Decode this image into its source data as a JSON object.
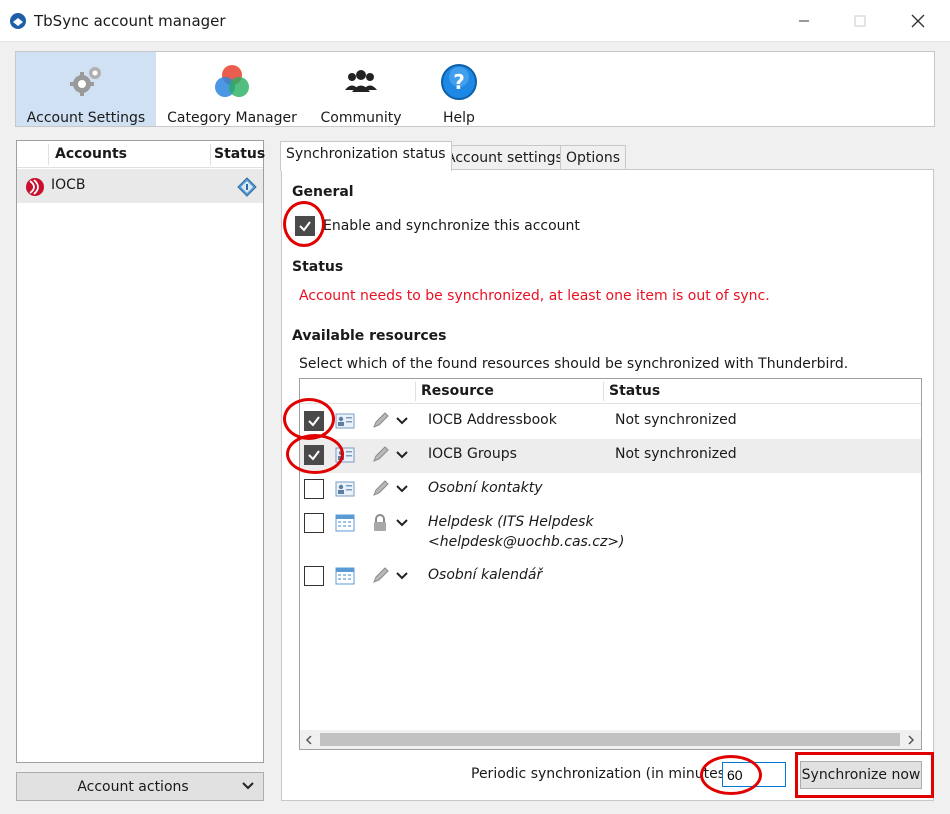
{
  "window": {
    "title": "TbSync account manager"
  },
  "toolbar": {
    "items": [
      {
        "label": "Account Settings",
        "icon": "gears-icon"
      },
      {
        "label": "Category Manager",
        "icon": "category-circles-icon"
      },
      {
        "label": "Community",
        "icon": "people-icon"
      },
      {
        "label": "Help",
        "icon": "help-icon"
      }
    ]
  },
  "accounts": {
    "col_accounts": "Accounts",
    "col_status": "Status",
    "items": [
      {
        "name": "IOCB",
        "icon": "exchange-provider-icon",
        "status_icon": "status-badge-icon"
      }
    ],
    "actions_label": "Account actions"
  },
  "tabs": [
    {
      "label": "Synchronization status"
    },
    {
      "label": "Account settings"
    },
    {
      "label": "Options"
    }
  ],
  "sync": {
    "general_heading": "General",
    "enable_label": "Enable and synchronize this account",
    "enable_checked": true,
    "status_heading": "Status",
    "status_message": "Account needs to be synchronized, at least one item is out of sync.",
    "resources_heading": "Available resources",
    "resources_desc": "Select which of the found resources should be synchronized with Thunderbird.",
    "col_resource": "Resource",
    "col_status": "Status",
    "resources": [
      {
        "name": "IOCB Addressbook",
        "status": "Not synchronized",
        "checked": true,
        "type": "addressbook-icon",
        "perm": "pencil-icon"
      },
      {
        "name": "IOCB Groups",
        "status": "Not synchronized",
        "checked": true,
        "type": "addressbook-icon",
        "perm": "pencil-icon"
      },
      {
        "name": "Osobní kontakty",
        "status": "",
        "checked": false,
        "type": "addressbook-icon",
        "perm": "pencil-icon"
      },
      {
        "name_line1": "Helpdesk (ITS Helpdesk",
        "name_line2": "<helpdesk@uochb.cas.cz>)",
        "status": "",
        "checked": false,
        "type": "calendar-icon",
        "perm": "lock-icon"
      },
      {
        "name": "Osobní kalendář",
        "status": "",
        "checked": false,
        "type": "calendar-icon",
        "perm": "pencil-icon"
      }
    ],
    "periodic_label": "Periodic synchronization (in minutes)",
    "periodic_value": "60",
    "sync_now_label": "Synchronize now"
  },
  "colors": {
    "accent": "#cfe1f3",
    "status_error": "#e81123",
    "annotation": "#e00000"
  }
}
